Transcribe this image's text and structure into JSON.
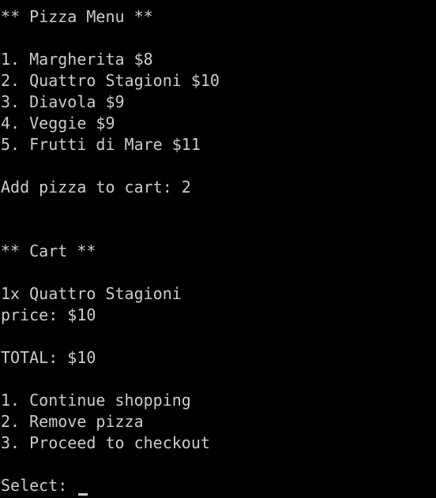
{
  "colors": {
    "background": "#000000",
    "text": "#cccccc"
  },
  "menu": {
    "header": "** Pizza Menu **",
    "items": [
      "1. Margherita $8",
      "2. Quattro Stagioni $10",
      "3. Diavola $9",
      "4. Veggie $9",
      "5. Frutti di Mare $11"
    ],
    "add_prompt": "Add pizza to cart: ",
    "add_input": "2"
  },
  "cart": {
    "header": "** Cart **",
    "item": "1x Quattro Stagioni",
    "price": "price: $10",
    "total": "TOTAL: $10",
    "options": [
      "1. Continue shopping",
      "2. Remove pizza",
      "3. Proceed to checkout"
    ],
    "select_prompt": "Select: "
  }
}
